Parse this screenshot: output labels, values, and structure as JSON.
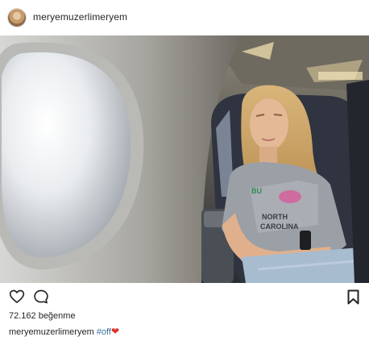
{
  "post": {
    "username": "meryemuzerlimeryem",
    "likes_text": "72.162 beğenme",
    "caption": {
      "username": "meryemuzerlimeryem",
      "hashtag": "#off",
      "emoji": "❤"
    }
  },
  "icons": {
    "like": "heart-outline-icon",
    "comment": "speech-bubble-icon",
    "save": "bookmark-icon",
    "caption_emoji": "red-heart-emoji"
  },
  "colors": {
    "text": "#262626",
    "hashtag": "#3f729b",
    "heart": "#e0322a",
    "border": "#dbdbdb"
  }
}
